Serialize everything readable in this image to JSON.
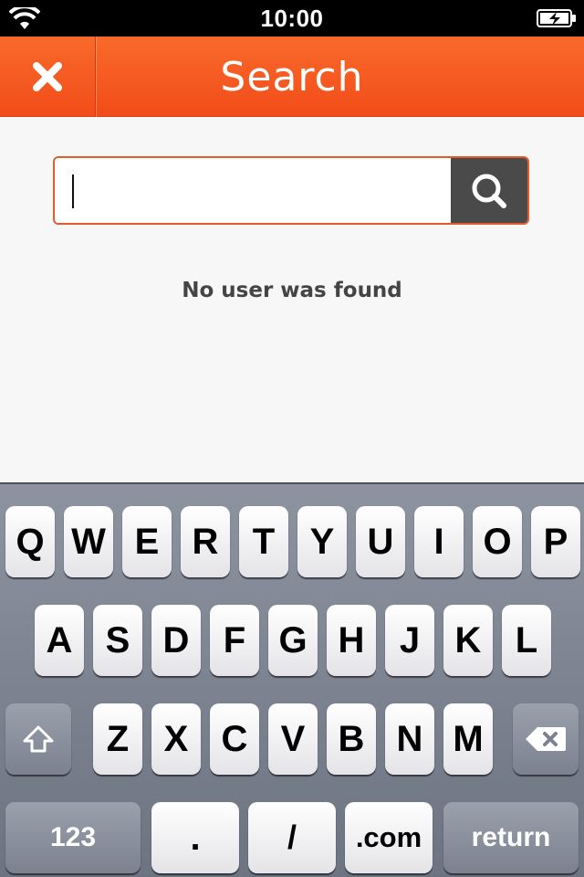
{
  "status_bar": {
    "time": "10:00"
  },
  "nav": {
    "title": "Search"
  },
  "search": {
    "value": "",
    "placeholder": ""
  },
  "results": {
    "empty_message": "No user was found"
  },
  "keyboard": {
    "row1": [
      "Q",
      "W",
      "E",
      "R",
      "T",
      "Y",
      "U",
      "I",
      "O",
      "P"
    ],
    "row2": [
      "A",
      "S",
      "D",
      "F",
      "G",
      "H",
      "J",
      "K",
      "L"
    ],
    "row3": [
      "Z",
      "X",
      "C",
      "V",
      "B",
      "N",
      "M"
    ],
    "numbers_label": "123",
    "dot_label": ".",
    "slash_label": "/",
    "dotcom_label": ".com",
    "return_label": "return"
  },
  "colors": {
    "accent": "#f25a22",
    "search_button": "#4a4a4a"
  }
}
